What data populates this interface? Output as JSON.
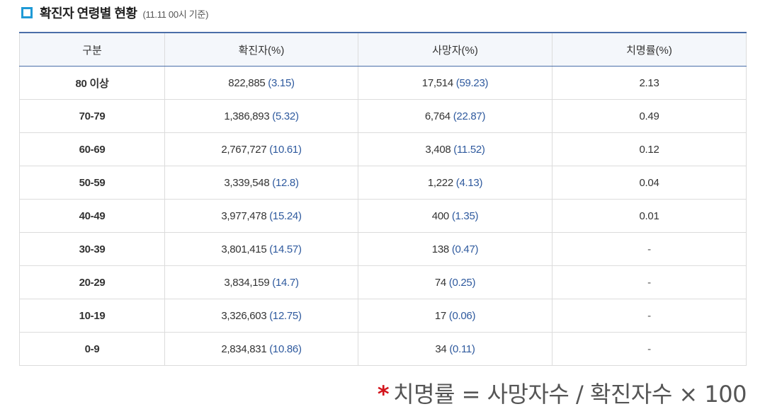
{
  "header": {
    "title": "확진자 연령별 현황",
    "note": "(11.11 00시 기준)"
  },
  "table": {
    "columns": [
      "구분",
      "확진자(%)",
      "사망자(%)",
      "치명률(%)"
    ],
    "rows": [
      {
        "age": "80 이상",
        "cases": "822,885",
        "cases_pct": "(3.15)",
        "deaths": "17,514",
        "deaths_pct": "(59.23)",
        "fatality": "2.13"
      },
      {
        "age": "70-79",
        "cases": "1,386,893",
        "cases_pct": "(5.32)",
        "deaths": "6,764",
        "deaths_pct": "(22.87)",
        "fatality": "0.49"
      },
      {
        "age": "60-69",
        "cases": "2,767,727",
        "cases_pct": "(10.61)",
        "deaths": "3,408",
        "deaths_pct": "(11.52)",
        "fatality": "0.12"
      },
      {
        "age": "50-59",
        "cases": "3,339,548",
        "cases_pct": "(12.8)",
        "deaths": "1,222",
        "deaths_pct": "(4.13)",
        "fatality": "0.04"
      },
      {
        "age": "40-49",
        "cases": "3,977,478",
        "cases_pct": "(15.24)",
        "deaths": "400",
        "deaths_pct": "(1.35)",
        "fatality": "0.01"
      },
      {
        "age": "30-39",
        "cases": "3,801,415",
        "cases_pct": "(14.57)",
        "deaths": "138",
        "deaths_pct": "(0.47)",
        "fatality": "-"
      },
      {
        "age": "20-29",
        "cases": "3,834,159",
        "cases_pct": "(14.7)",
        "deaths": "74",
        "deaths_pct": "(0.25)",
        "fatality": "-"
      },
      {
        "age": "10-19",
        "cases": "3,326,603",
        "cases_pct": "(12.75)",
        "deaths": "17",
        "deaths_pct": "(0.06)",
        "fatality": "-"
      },
      {
        "age": "0-9",
        "cases": "2,834,831",
        "cases_pct": "(10.86)",
        "deaths": "34",
        "deaths_pct": "(0.11)",
        "fatality": "-"
      }
    ]
  },
  "footnote": {
    "star": "*",
    "formula": "치명률 = 사망자수 / 확진자수 × 100"
  },
  "colors": {
    "accent": "#1f9ad6",
    "header_border": "#4a6ea8",
    "percent_text": "#2f5a9e",
    "star": "#d3141c"
  },
  "icons": {
    "title_marker": "square-bullet-icon"
  }
}
